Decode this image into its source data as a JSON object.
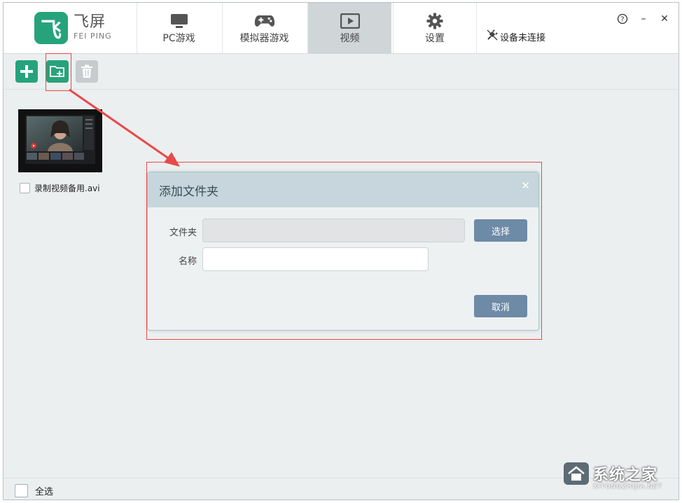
{
  "app": {
    "logo_glyph": "飞",
    "brand_name": "飞屏",
    "brand_sub": "FEI PING"
  },
  "tabs": [
    {
      "label": "PC游戏",
      "icon": "monitor-icon",
      "active": false
    },
    {
      "label": "模拟器游戏",
      "icon": "gamepad-icon",
      "active": false
    },
    {
      "label": "视频",
      "icon": "video-play-icon",
      "active": true
    },
    {
      "label": "设置",
      "icon": "gear-icon",
      "active": false
    }
  ],
  "device_status": {
    "label": "设备未连接",
    "icon": "disconnected-plug-icon"
  },
  "window_controls": {
    "help": "?",
    "minimize": "–",
    "close": "✕"
  },
  "toolbar": {
    "add_icon": "plus-icon",
    "add_folder_icon": "add-folder-icon",
    "delete_icon": "trash-icon"
  },
  "videos": [
    {
      "name": "录制视频备用.avi",
      "checked": false
    }
  ],
  "footer": {
    "select_all_label": "全选",
    "checked": false
  },
  "dialog": {
    "title": "添加文件夹",
    "close_glyph": "✕",
    "folder_label": "文件夹",
    "folder_value": "",
    "choose_button": "选择",
    "name_label": "名称",
    "name_value": "",
    "cancel_button": "取消"
  },
  "watermark": {
    "text": "系统之家",
    "sub": "XITONGZHIJIA.NET"
  },
  "colors": {
    "accent_green": "#26a37a",
    "dialog_button": "#6d8aa6",
    "annotation_red": "#e84a4a",
    "active_tab": "#d0d5d8"
  }
}
